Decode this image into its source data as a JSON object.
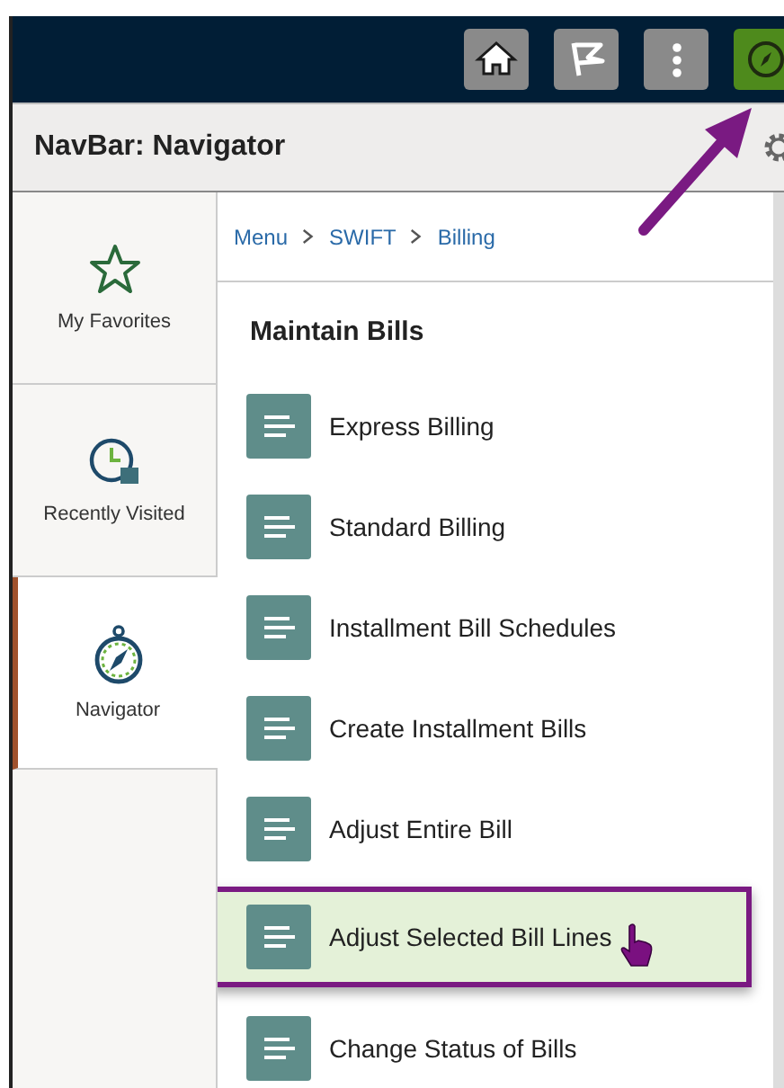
{
  "toolbar_buttons": [
    {
      "kind": "home",
      "selected": false
    },
    {
      "kind": "flag",
      "selected": false
    },
    {
      "kind": "more",
      "selected": false
    },
    {
      "kind": "compass",
      "selected": true
    }
  ],
  "title_bar": {
    "title": "NavBar: Navigator"
  },
  "sidebar": {
    "items": [
      {
        "kind": "favorites",
        "label": "My Favorites",
        "selected": false
      },
      {
        "kind": "recent",
        "label": "Recently Visited",
        "selected": false
      },
      {
        "kind": "navigator",
        "label": "Navigator",
        "selected": true
      }
    ]
  },
  "breadcrumb": [
    "Menu",
    "SWIFT",
    "Billing"
  ],
  "section": {
    "heading": "Maintain Bills",
    "items": [
      {
        "label": "Express Billing",
        "selected": false
      },
      {
        "label": "Standard Billing",
        "selected": false
      },
      {
        "label": "Installment Bill Schedules",
        "selected": false
      },
      {
        "label": "Create Installment Bills",
        "selected": false
      },
      {
        "label": "Adjust Entire Bill",
        "selected": false
      },
      {
        "label": "Adjust Selected Bill Lines",
        "selected": true
      },
      {
        "label": "Change Status of Bills",
        "selected": false
      }
    ]
  }
}
